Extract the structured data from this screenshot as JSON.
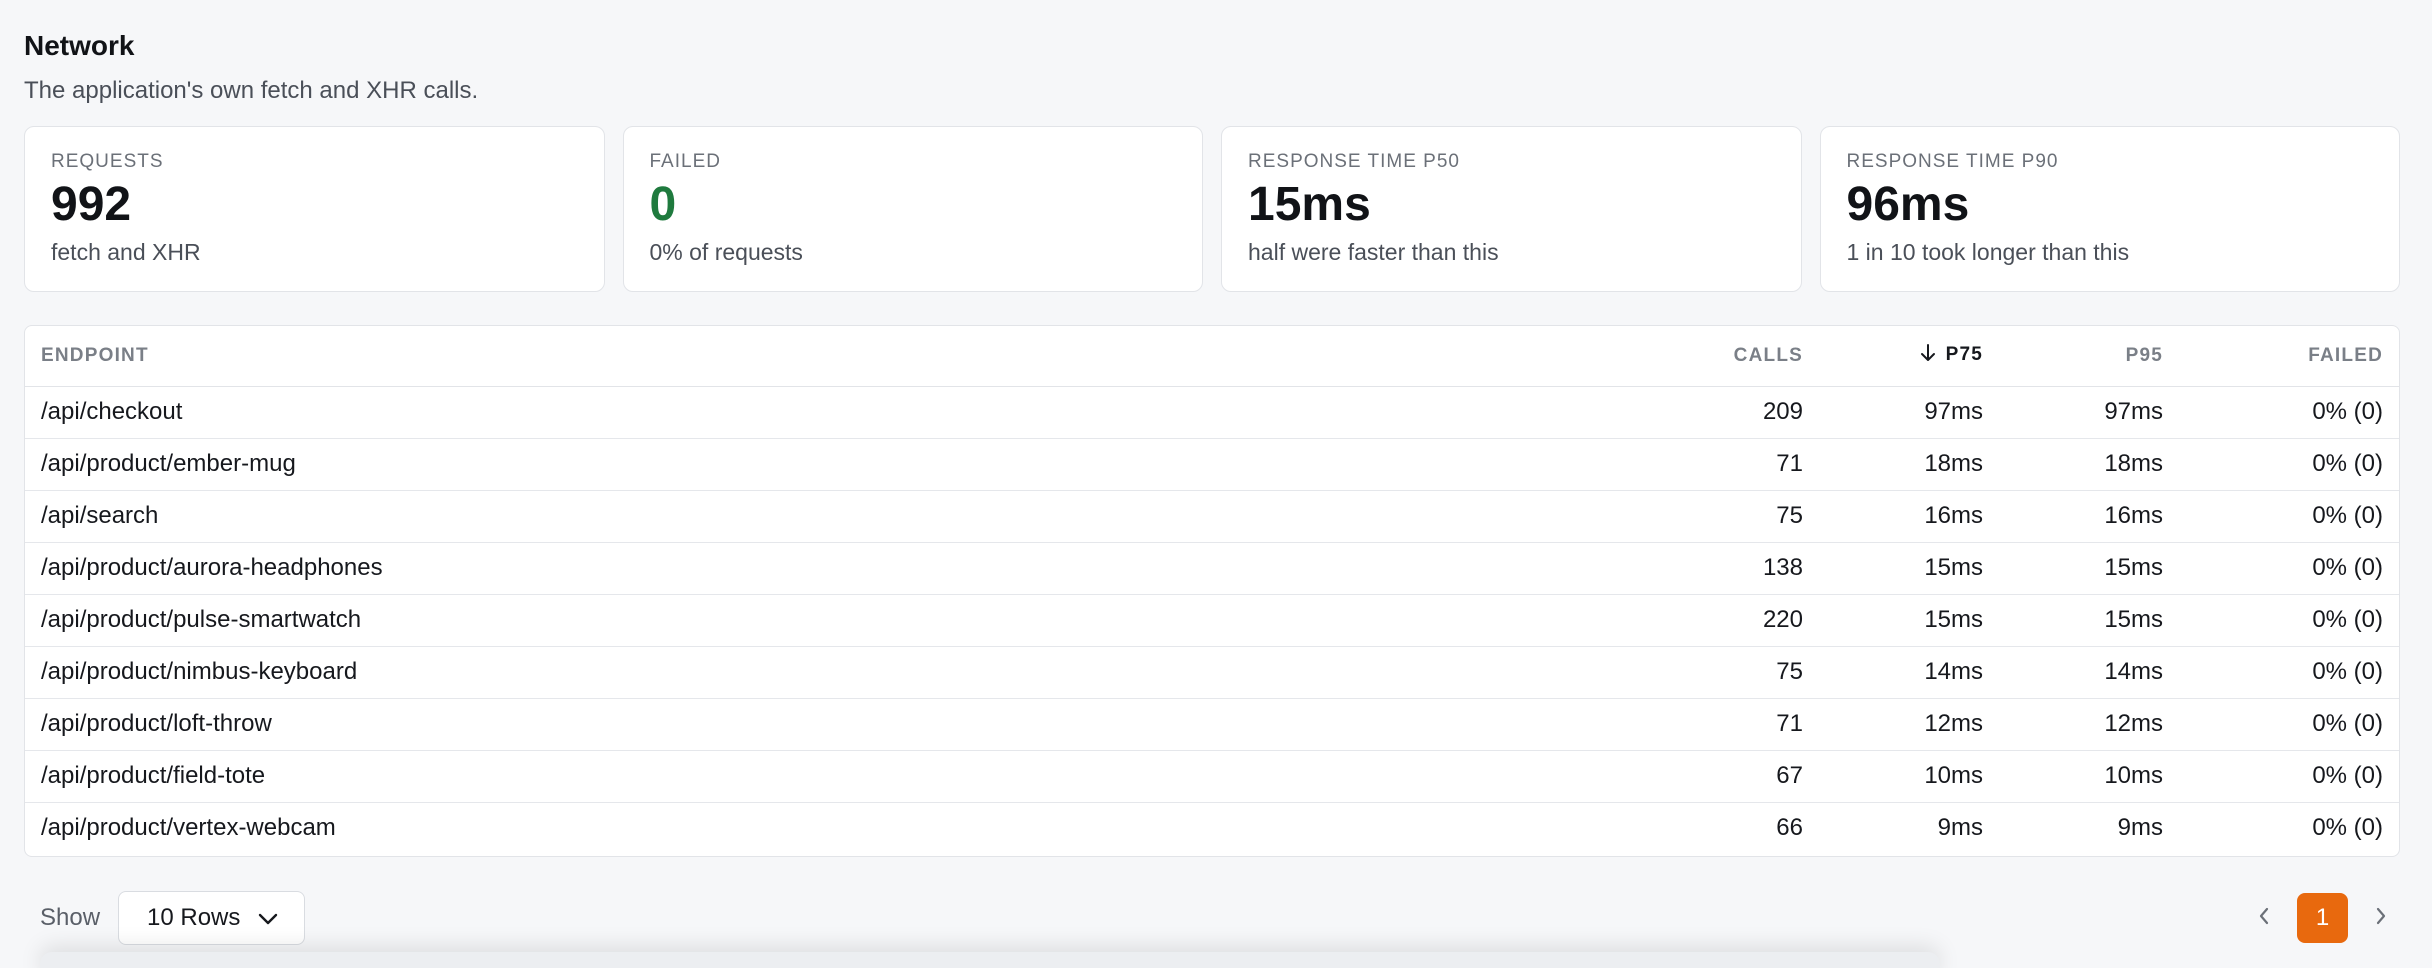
{
  "header": {
    "title": "Network",
    "subtitle": "The application's own fetch and XHR calls."
  },
  "cards": [
    {
      "label": "REQUESTS",
      "value": "992",
      "sub": "fetch and XHR"
    },
    {
      "label": "FAILED",
      "value": "0",
      "sub": "0% of requests",
      "value_color": "#1f7a3e"
    },
    {
      "label": "RESPONSE TIME P50",
      "value": "15ms",
      "sub": "half were faster than this"
    },
    {
      "label": "RESPONSE TIME P90",
      "value": "96ms",
      "sub": "1 in 10 took longer than this"
    }
  ],
  "table": {
    "columns": {
      "endpoint": "ENDPOINT",
      "calls": "CALLS",
      "p75": "P75",
      "p95": "P95",
      "failed": "FAILED"
    },
    "sorted_column": "p75",
    "sort_direction": "descending",
    "rows": [
      {
        "endpoint": "/api/checkout",
        "calls": "209",
        "p75": "97ms",
        "p95": "97ms",
        "failed": "0% (0)"
      },
      {
        "endpoint": "/api/product/ember-mug",
        "calls": "71",
        "p75": "18ms",
        "p95": "18ms",
        "failed": "0% (0)"
      },
      {
        "endpoint": "/api/search",
        "calls": "75",
        "p75": "16ms",
        "p95": "16ms",
        "failed": "0% (0)"
      },
      {
        "endpoint": "/api/product/aurora-headphones",
        "calls": "138",
        "p75": "15ms",
        "p95": "15ms",
        "failed": "0% (0)"
      },
      {
        "endpoint": "/api/product/pulse-smartwatch",
        "calls": "220",
        "p75": "15ms",
        "p95": "15ms",
        "failed": "0% (0)"
      },
      {
        "endpoint": "/api/product/nimbus-keyboard",
        "calls": "75",
        "p75": "14ms",
        "p95": "14ms",
        "failed": "0% (0)"
      },
      {
        "endpoint": "/api/product/loft-throw",
        "calls": "71",
        "p75": "12ms",
        "p95": "12ms",
        "failed": "0% (0)"
      },
      {
        "endpoint": "/api/product/field-tote",
        "calls": "67",
        "p75": "10ms",
        "p95": "10ms",
        "failed": "0% (0)"
      },
      {
        "endpoint": "/api/product/vertex-webcam",
        "calls": "66",
        "p75": "9ms",
        "p95": "9ms",
        "failed": "0% (0)"
      }
    ]
  },
  "footer": {
    "show_label": "Show",
    "rows_select_value": "10 Rows",
    "current_page": "1"
  },
  "colors": {
    "accent": "#e8690e",
    "success": "#1f7a3e"
  }
}
